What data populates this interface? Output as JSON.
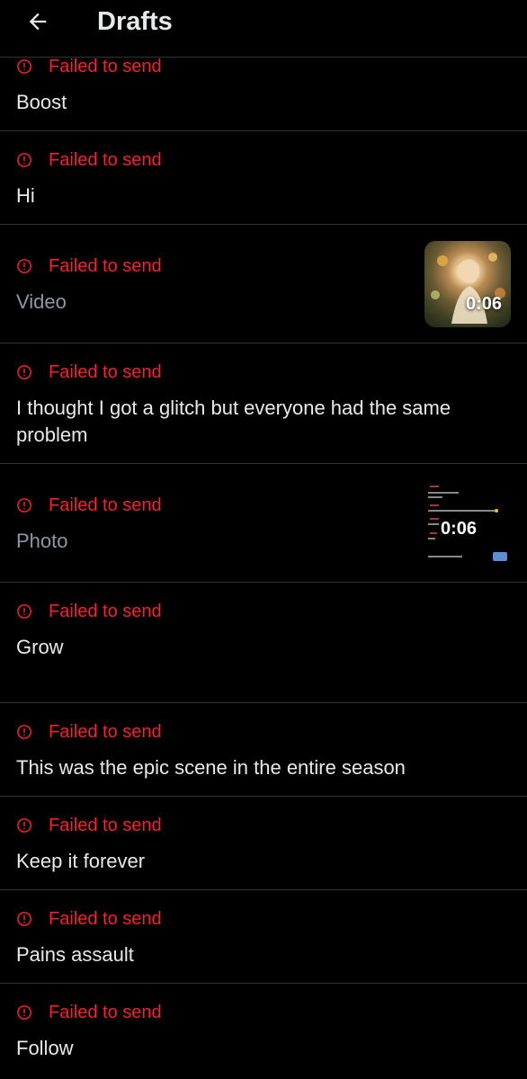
{
  "header": {
    "title": "Drafts",
    "back_icon": "arrow-left-icon"
  },
  "colors": {
    "error": "#f4212e",
    "divider": "#2f3336",
    "muted": "#8b98a5"
  },
  "drafts": [
    {
      "status": "Failed to send",
      "text": "Boost"
    },
    {
      "status": "Failed to send",
      "text": "Hi"
    },
    {
      "status": "Failed to send",
      "text": "Video",
      "media": {
        "kind": "video-thumbnail",
        "duration": "0:06"
      }
    },
    {
      "status": "Failed to send",
      "text": "I thought I got a glitch but everyone had the same problem"
    },
    {
      "status": "Failed to send",
      "text": "Photo",
      "media": {
        "kind": "screenshot-thumbnail",
        "duration": "0:06"
      }
    },
    {
      "status": "Failed to send",
      "text": "Grow"
    },
    {
      "status": "Failed to send",
      "text": "This was the epic scene in the entire season"
    },
    {
      "status": "Failed to send",
      "text": "Keep it forever"
    },
    {
      "status": "Failed to send",
      "text": "Pains assault"
    },
    {
      "status": "Failed to send",
      "text": "Follow"
    }
  ]
}
